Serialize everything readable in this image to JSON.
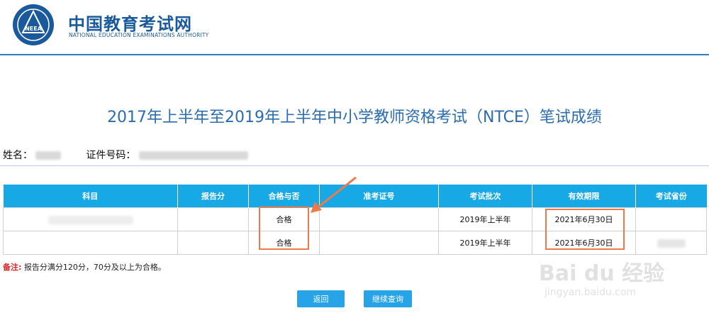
{
  "header": {
    "logo_cn": "中国教育考试网",
    "logo_en": "NATIONAL EDUCATION EXAMINATIONS AUTHORITY",
    "emblem_text": "NEEA",
    "colors": {
      "brand": "#1a5a9c",
      "accent": "#2f7fbf"
    }
  },
  "page_title": "2017年上半年至2019年上半年中小学教师资格考试（NTCE）笔试成绩",
  "candidate": {
    "name_label": "姓名：",
    "id_label": "证件号码："
  },
  "table": {
    "headers": [
      "科目",
      "报告分",
      "合格与否",
      "准考证号",
      "考试批次",
      "有效期限",
      "考试省份"
    ],
    "header_color": "#17a9e6",
    "rows": [
      {
        "result": "合格",
        "batch": "2019年上半年",
        "valid_until": "2021年6月30日"
      },
      {
        "result": "合格",
        "batch": "2019年上半年",
        "valid_until": "2021年6月30日"
      }
    ]
  },
  "note": {
    "label": "备注:",
    "text": "报告分满分120分，70分及以上为合格。"
  },
  "buttons": {
    "back": "返回",
    "continue": "继续查询",
    "color": "#27a3e8"
  },
  "watermark": {
    "brand": "Bai du 经验",
    "url": "jingyan.baidu.com"
  },
  "annotation_color": "#ee7a4a"
}
